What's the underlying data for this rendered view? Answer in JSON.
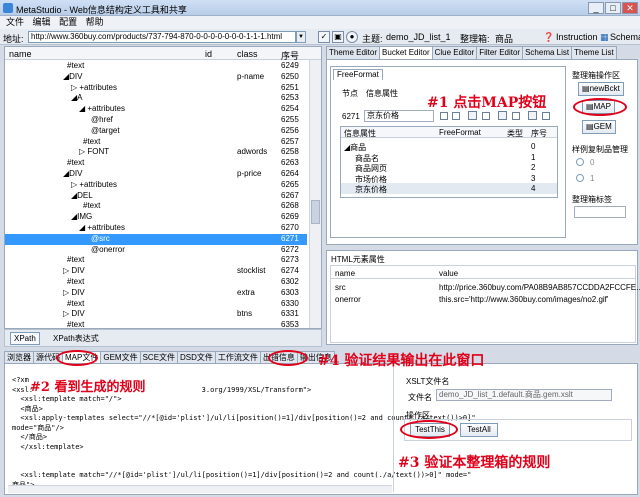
{
  "window": {
    "title": "MetaStudio - Web信息结构定义工具和共享",
    "min": "_",
    "max": "□",
    "close": "✕"
  },
  "menu": [
    "文件",
    "编辑",
    "配置",
    "帮助"
  ],
  "addressbar": {
    "label": "地址:",
    "url": "http://www.360buy.com/products/737-794-870-0-0-0-0-0-0-0-1-1-1.html",
    "theme_label": "主题:",
    "theme_value": "demo_JD_list_1",
    "box_label": "整理箱:",
    "box_value": "商品",
    "instruction": "Instruction",
    "schema": "Schema"
  },
  "tree": {
    "columns": [
      "name",
      "id",
      "class",
      "序号"
    ],
    "rows": [
      {
        "indent": 62,
        "name": "#text",
        "id": "",
        "class": "",
        "no": "6249"
      },
      {
        "indent": 58,
        "name": "◢DIV",
        "id": "",
        "class": "p-name",
        "no": "6250"
      },
      {
        "indent": 66,
        "name": "▷ +attributes",
        "id": "",
        "class": "",
        "no": "6251"
      },
      {
        "indent": 66,
        "name": "◢A",
        "id": "",
        "class": "",
        "no": "6253"
      },
      {
        "indent": 74,
        "name": "◢ +attributes",
        "id": "",
        "class": "",
        "no": "6254"
      },
      {
        "indent": 86,
        "name": "@href",
        "id": "",
        "class": "",
        "no": "6255"
      },
      {
        "indent": 86,
        "name": "@target",
        "id": "",
        "class": "",
        "no": "6256"
      },
      {
        "indent": 78,
        "name": "#text",
        "id": "",
        "class": "",
        "no": "6257"
      },
      {
        "indent": 74,
        "name": "▷ FONT",
        "id": "",
        "class": "adwords",
        "no": "6258"
      },
      {
        "indent": 62,
        "name": "#text",
        "id": "",
        "class": "",
        "no": "6263"
      },
      {
        "indent": 58,
        "name": "◢DIV",
        "id": "",
        "class": "p-price",
        "no": "6264"
      },
      {
        "indent": 66,
        "name": "▷ +attributes",
        "id": "",
        "class": "",
        "no": "6265"
      },
      {
        "indent": 66,
        "name": "◢DEL",
        "id": "",
        "class": "",
        "no": "6267"
      },
      {
        "indent": 78,
        "name": "#text",
        "id": "",
        "class": "",
        "no": "6268"
      },
      {
        "indent": 66,
        "name": "◢IMG",
        "id": "",
        "class": "",
        "no": "6269"
      },
      {
        "indent": 74,
        "name": "◢ +attributes",
        "id": "",
        "class": "",
        "no": "6270"
      },
      {
        "indent": 86,
        "name": "@src",
        "id": "",
        "class": "",
        "no": "6271",
        "selected": true
      },
      {
        "indent": 86,
        "name": "@onerror",
        "id": "",
        "class": "",
        "no": "6272"
      },
      {
        "indent": 62,
        "name": "#text",
        "id": "",
        "class": "",
        "no": "6273"
      },
      {
        "indent": 58,
        "name": "▷ DIV",
        "id": "",
        "class": "stocklist",
        "no": "6274"
      },
      {
        "indent": 62,
        "name": "#text",
        "id": "",
        "class": "",
        "no": "6302"
      },
      {
        "indent": 58,
        "name": "▷ DIV",
        "id": "",
        "class": "extra",
        "no": "6303"
      },
      {
        "indent": 62,
        "name": "#text",
        "id": "",
        "class": "",
        "no": "6330"
      },
      {
        "indent": 58,
        "name": "▷ DIV",
        "id": "",
        "class": "btns",
        "no": "6331"
      },
      {
        "indent": 62,
        "name": "#text",
        "id": "",
        "class": "",
        "no": "6353"
      }
    ]
  },
  "xpathbar": {
    "button": "XPath",
    "label": "XPath表达式"
  },
  "right_tabs": [
    "Theme Editor",
    "Bucket Editor",
    "Clue Editor",
    "Filter Editor",
    "Schema List",
    "Theme List"
  ],
  "bucket": {
    "subtab": "FreeFormat",
    "node_label": "节点",
    "info_label": "信息属性",
    "node_value": "6271",
    "info_value": "京东价格",
    "grid_headers": [
      "信息属性",
      "FreeFormat",
      "类型",
      "序号"
    ],
    "grid_rows": [
      {
        "name": "◢商品",
        "no": "0"
      },
      {
        "name": "商品名",
        "no": "1"
      },
      {
        "name": "商品网页",
        "no": "2"
      },
      {
        "name": "市场价格",
        "no": "3"
      },
      {
        "name": "京东价格",
        "no": "4"
      }
    ],
    "ops_label": "整理箱操作区",
    "new_btn": "newBckt",
    "map_btn": "MAP",
    "gem_btn": "GEM",
    "sample_label": "样例复制品管理",
    "radio_0": "0",
    "radio_1": "1",
    "tag_label": "整理箱标签"
  },
  "html_attrs": {
    "title": "HTML元素属性",
    "headers": [
      "name",
      "value"
    ],
    "rows": [
      {
        "name": "src",
        "value": "http://price.360buy.com/PA08B9AB857CCDDA2FCCFE..."
      },
      {
        "name": "onerror",
        "value": "this.src='http://www.360buy.com/images/no2.gif'"
      }
    ]
  },
  "bottom_tabs": [
    "浏览器",
    "源代码",
    "MAP文件",
    "GEM文件",
    "SCE文件",
    "DSD文件",
    "工作流文件",
    "出错信息",
    "输出信息"
  ],
  "code_lines": [
    "<?xm",
    "<xsl:                                        3.org/1999/XSL/Transform\">",
    "  <xsl:template match=\"/\">",
    "  <商品>",
    "  <xsl:apply-templates select=\"//*[@id='plist']/ul/li[position()=1]/div[position()=2 and count(./a/text())>0]\"",
    "mode=\"商品\"/>",
    "  </商品>",
    "  </xsl:template>",
    "",
    "",
    "  <xsl:template match=\"//*[@id='plist']/ul/li[position()=1]/div[position()=2 and count(./a/text())>0]\" mode=\"",
    "商品\">"
  ],
  "xslt": {
    "title": "XSLT文件名",
    "file_label": "文件名",
    "file_value": "demo_JD_list_1.default.商品.gem.xslt",
    "ops_label": "操作区",
    "test_this": "TestThis",
    "test_all": "TestAll"
  },
  "annotations": {
    "a1": "#1 点击MAP按钮",
    "a2": "#2 看到生成的规则",
    "a3": "#3 验证本整理箱的规则",
    "a4": "#4 验证结果输出在此窗口"
  }
}
